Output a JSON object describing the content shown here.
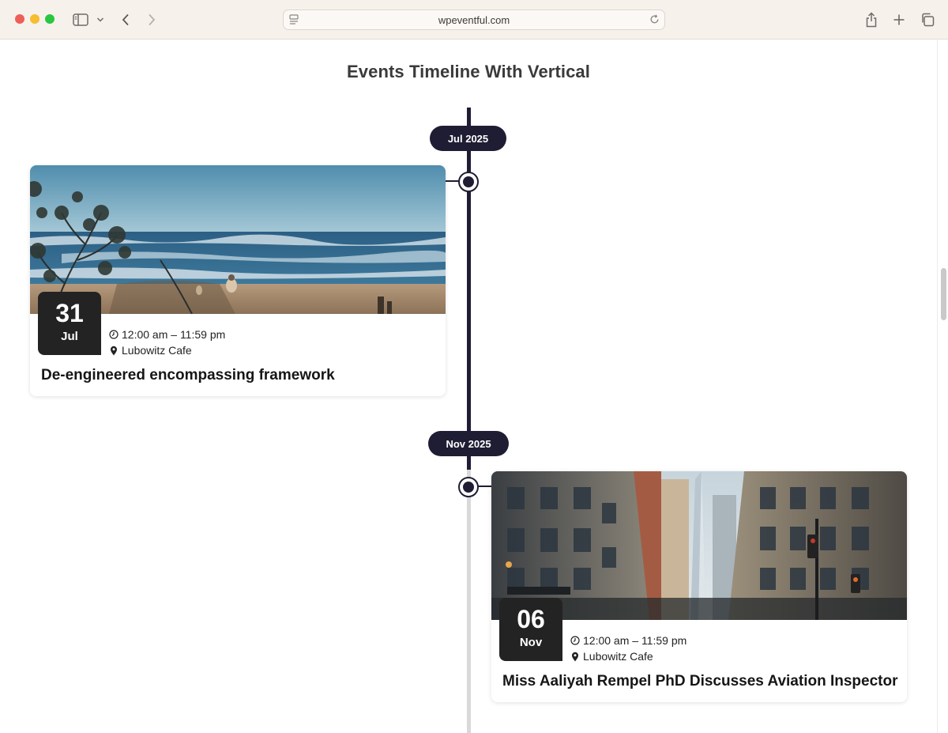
{
  "browser": {
    "url": "wpeventful.com"
  },
  "page": {
    "title": "Events Timeline With Vertical"
  },
  "timeline": {
    "groups": [
      {
        "month_label": "Jul 2025",
        "event": {
          "day": "31",
          "month": "Jul",
          "time": "12:00 am – 11:59 pm",
          "location": "Lubowitz Cafe",
          "title": "De-engineered encompassing framework",
          "image": "beach-photo"
        }
      },
      {
        "month_label": "Nov 2025",
        "event": {
          "day": "06",
          "month": "Nov",
          "time": "12:00 am – 11:59 pm",
          "location": "Lubowitz Cafe",
          "title": "Miss Aaliyah Rempel PhD Discusses Aviation Inspector",
          "image": "city-street-photo"
        }
      }
    ]
  },
  "colors": {
    "timeline": "#1f1d33",
    "date_box": "#232323",
    "chrome_bg": "#f7f1ec"
  },
  "icons": [
    "sidebar-icon",
    "chevron-down-icon",
    "back-icon",
    "forward-icon",
    "reader-icon",
    "reload-icon",
    "share-icon",
    "plus-icon",
    "tabs-icon",
    "clock-icon",
    "map-pin-icon"
  ]
}
